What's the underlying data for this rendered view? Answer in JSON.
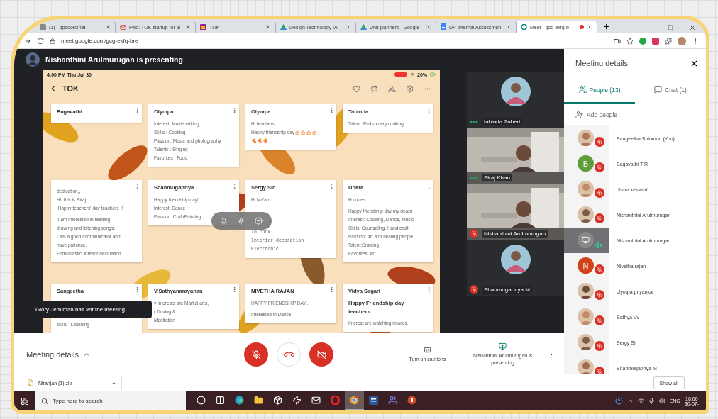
{
  "browser": {
    "tabs": [
      {
        "kind": "page",
        "label": "(1) - dpcoordinat",
        "selected": false,
        "recording": false
      },
      {
        "kind": "mail",
        "label": "Fwd: TOK startup for te",
        "selected": false,
        "recording": false
      },
      {
        "kind": "slides",
        "label": "TOK",
        "selected": false,
        "recording": false
      },
      {
        "kind": "drive",
        "label": "Design Technology IA -",
        "selected": false,
        "recording": false
      },
      {
        "kind": "drive",
        "label": "Unit planners - Google",
        "selected": false,
        "recording": false
      },
      {
        "kind": "docs",
        "label": "DP-Internal Assessmen",
        "selected": false,
        "recording": false
      },
      {
        "kind": "meet",
        "label": "Meet - gcg-ekfq-b",
        "selected": true,
        "recording": true
      }
    ],
    "address": "meet.google.com/gcg-ekfq-bre"
  },
  "meet": {
    "presenter_banner": "Nishanthini Arulmurugan is presenting",
    "presentation": {
      "clock": "4:00 PM  Thu Jul 30",
      "battery": "20%",
      "title": "TOK",
      "cards": [
        {
          "title": "Bagavathi"
        },
        {
          "title": "Olympa",
          "paragraphs": [
            {
              "kind": "plain",
              "lines": [
                "Interest: Movie editing",
                "Skills : Cooking",
                "Passion: Music and photography",
                "Talents : Singing",
                "Favorites : Food"
              ]
            }
          ]
        },
        {
          "title": "Olympa",
          "paragraphs": [
            {
              "kind": "plain",
              "lines": [
                "Hi teachers,",
                "Happy friendship day🎂🎂🎂🎂",
                "🍕🍕🍕"
              ]
            }
          ]
        },
        {
          "title": "Tabinda",
          "paragraphs": [
            {
              "kind": "plain",
              "lines": [
                "Talent :Embroidery,cooking"
              ]
            }
          ]
        },
        {
          "paragraphs": [
            {
              "kind": "plain",
              "lines": [
                "dedication,,",
                "Hi, this is Siraj,",
                " Happy teachers' day teachers !!"
              ]
            },
            {
              "kind": "plain",
              "lines": [
                " I am interested in reading,",
                "drawing and listening songs.",
                "I am a good communicator and",
                "have patience.",
                "Enthusiastic, interior decoration"
              ]
            }
          ]
        },
        {
          "title": "Shanmugapriya",
          "paragraphs": [
            {
              "kind": "plain",
              "lines": [
                "Happy friendship day!",
                "Interest: Dance",
                "Passion: Craft/Painting"
              ]
            }
          ]
        },
        {
          "title": "Sergy Sir",
          "paragraphs": [
            {
              "kind": "plain",
              "lines": [
                "Hi Ma'am"
              ]
            },
            {
              "kind": "mono",
              "lines": [
                "To cook",
                "Interior decoration",
                "Electronic"
              ]
            }
          ]
        },
        {
          "title": "Dhara",
          "paragraphs": [
            {
              "kind": "plain",
              "lines": [
                "H dudes"
              ]
            },
            {
              "kind": "plain",
              "lines": [
                "Happy friendship day my dears",
                "Interest: Cooking, Dance, Music",
                "Skills: Counseling, Handicraft",
                "Passion: Art and healing people",
                "Talent:Drawing",
                "Favorites: Art"
              ]
            }
          ]
        },
        {
          "title": "Sangeetha",
          "paragraphs": [
            {
              "kind": "spaced",
              "lines": [
                "skills-  Listening"
              ]
            }
          ]
        },
        {
          "title": "V.Sathyanarayanan",
          "paragraphs": [
            {
              "kind": "plain",
              "lines": [
                "y Interests are Martial arts,",
                "r Driving &",
                "Meditation"
              ]
            }
          ]
        },
        {
          "title": "NIVETHA RAJAN",
          "paragraphs": [
            {
              "kind": "plain",
              "lines": [
                "HAPPY FRIENDSHIP DAY..."
              ]
            },
            {
              "kind": "plain",
              "lines": [
                "Interested in Dance"
              ]
            }
          ]
        },
        {
          "title": "Vidya Sagari",
          "paragraphs": [
            {
              "kind": "bold",
              "lines": [
                "Happy Friendship day",
                "teachers."
              ]
            },
            {
              "kind": "plain",
              "lines": [
                "Interest are watching movies,"
              ]
            }
          ]
        }
      ]
    },
    "toast": "Glory Jemimah has left the meeting",
    "tiles": [
      {
        "name": "tabinda Zuberi",
        "kind": "avatar",
        "muted": false
      },
      {
        "name": "Siraj Khan",
        "kind": "video",
        "muted": false
      },
      {
        "name": "Nishanthini Arulmurugan",
        "kind": "video",
        "muted": true
      },
      {
        "name": "Shanmugapriya M",
        "kind": "avatar",
        "muted": true
      }
    ],
    "controls": {
      "details": "Meeting details",
      "mic_on": false,
      "camera_on": false,
      "captions": "Turn on captions",
      "presenting": "Nishanthini Arulmurugan is presenting"
    }
  },
  "panel": {
    "title": "Meeting details",
    "tabs": [
      {
        "kind": "people",
        "label": "People (13)",
        "selected": true
      },
      {
        "kind": "chat",
        "label": "Chat (1)",
        "selected": false
      }
    ],
    "add_people": "Add people",
    "people": [
      {
        "name": "Sangeetha Solomon (You)",
        "muted": true,
        "selected": false
      },
      {
        "name": "Bagavathi T R",
        "kind": "letter",
        "letter": "B",
        "color": "#5f9e3a",
        "muted": true,
        "selected": false
      },
      {
        "name": "dhara keswari",
        "muted": true,
        "selected": false
      },
      {
        "name": "Nishanthini Arulmurugan",
        "muted": true,
        "selected": false
      },
      {
        "name": "Nishanthini Arulmurugan",
        "kind": "screen",
        "muted": false,
        "selected": true
      },
      {
        "name": "Nivetha rajan",
        "kind": "letter",
        "letter": "N",
        "color": "#d2431c",
        "muted": true,
        "selected": false
      },
      {
        "name": "olympa priyanka",
        "muted": true,
        "selected": false
      },
      {
        "name": "Sathya Vv",
        "muted": true,
        "selected": false
      },
      {
        "name": "Sergy Sir",
        "muted": true,
        "selected": false
      },
      {
        "name": "Shanmugapriya M",
        "muted": true,
        "selected": false
      }
    ]
  },
  "downloads": {
    "file": "Niranjan (1).zip",
    "show_all": "Show all"
  },
  "taskbar": {
    "search": "Type here to search",
    "apps": [
      {
        "kind": "cortana",
        "active": false
      },
      {
        "kind": "taskview",
        "active": false
      },
      {
        "kind": "edge",
        "active": false
      },
      {
        "kind": "explorer",
        "active": false
      },
      {
        "kind": "dropbox",
        "active": false
      },
      {
        "kind": "bolt",
        "active": false
      },
      {
        "kind": "mail",
        "active": false
      },
      {
        "kind": "opera",
        "active": false
      },
      {
        "kind": "chrome",
        "active": true
      },
      {
        "kind": "word",
        "active": false
      },
      {
        "kind": "teams",
        "active": false
      },
      {
        "kind": "powerpoint",
        "active": false
      }
    ],
    "language": "ENG",
    "time": "16:00",
    "date": "30-07-"
  }
}
